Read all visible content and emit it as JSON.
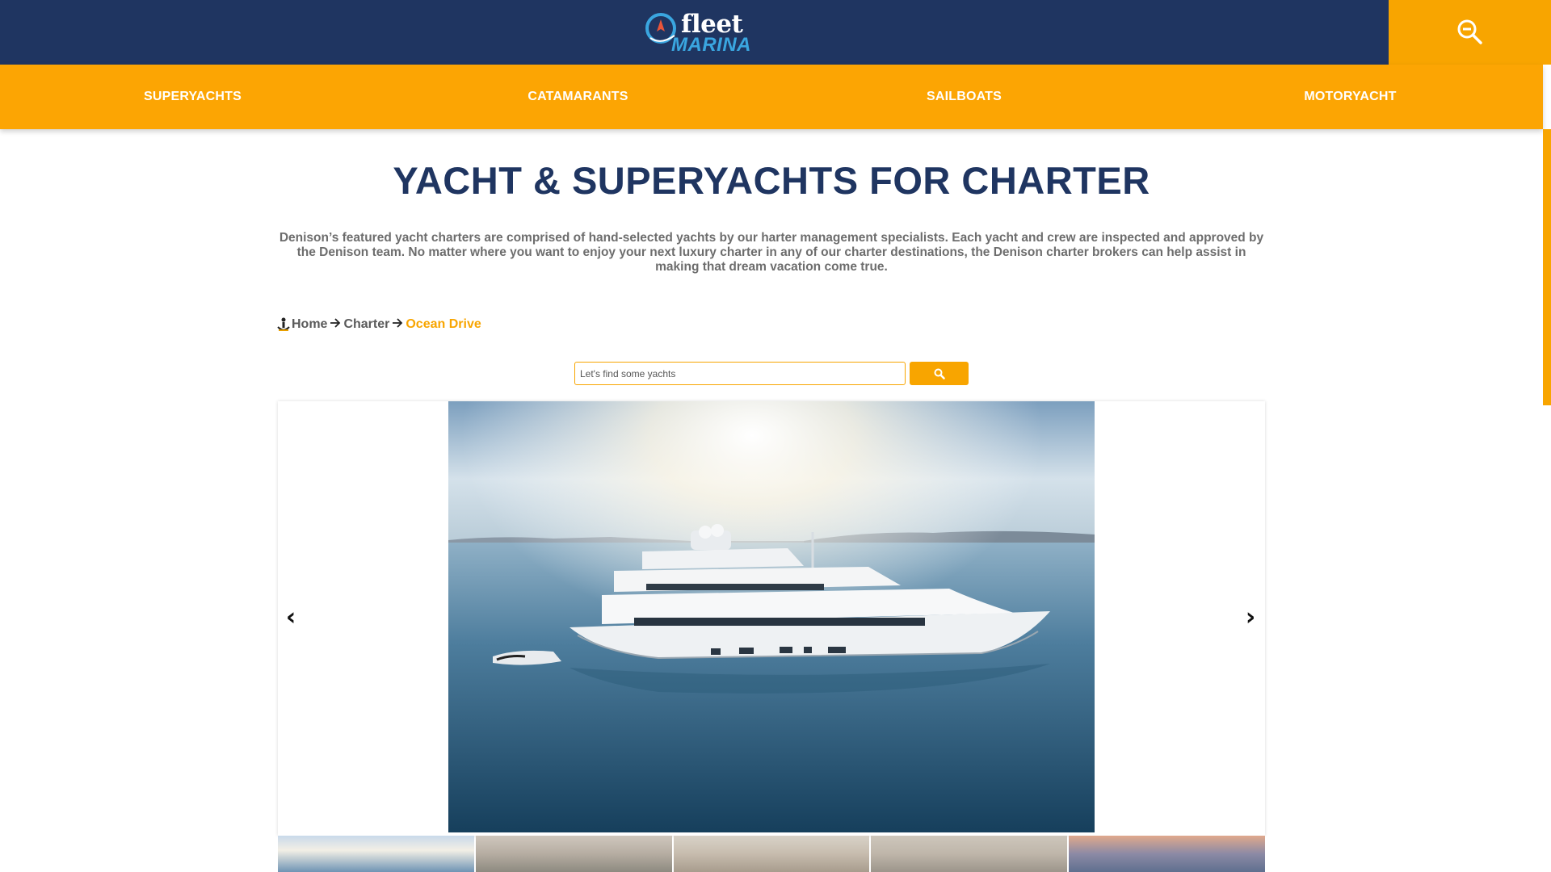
{
  "brand": {
    "logo_top": "fleet",
    "logo_bottom": "MARINA",
    "colors": {
      "navy": "#1f3561",
      "orange": "#fca503",
      "accent_blue": "#3aa6e0",
      "text_gray": "#6d6d6d"
    }
  },
  "header": {
    "search_toggle_icon": "zoom-out-magnifier-icon"
  },
  "nav": {
    "items": [
      {
        "label": "SUPERYACHTS"
      },
      {
        "label": "CATAMARANTS"
      },
      {
        "label": "SAILBOATS"
      },
      {
        "label": "MOTORYACHT"
      }
    ]
  },
  "page": {
    "title": "YACHT & SUPERYACHTS FOR CHARTER",
    "intro": "Denison’s featured yacht charters are comprised of hand-selected yachts by our harter management specialists. Each yacht and crew are inspected and approved by the Denison team. No matter where you want to enjoy your next luxury charter in any of our charter destinations, the Denison charter brokers can help assist in making that dream vacation come true."
  },
  "breadcrumb": {
    "icon": "person-anchor-icon",
    "items": [
      {
        "label": "Home"
      },
      {
        "label": "Charter"
      },
      {
        "label": "Ocean Drive"
      }
    ],
    "separator": "🡒"
  },
  "search": {
    "placeholder": "Let's find some yachts",
    "button_icon": "search-icon"
  },
  "carousel": {
    "prev_label": "‹",
    "next_label": "›",
    "main_image": "superyacht-at-sea-photo",
    "thumbnails": [
      "sunset-sea-thumb",
      "interior-salon-thumb",
      "interior-deck-thumb",
      "interior-lounge-thumb",
      "sunset-deck-thumb"
    ]
  }
}
